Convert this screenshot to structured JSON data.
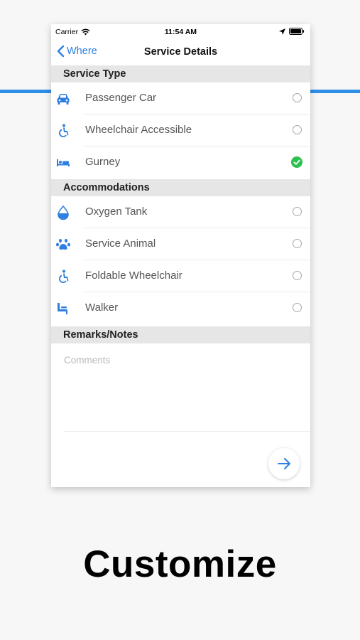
{
  "status_bar": {
    "carrier": "Carrier",
    "time": "11:54 AM"
  },
  "nav": {
    "back_label": "Where",
    "title": "Service Details"
  },
  "service_type": {
    "header": "Service Type",
    "items": [
      {
        "label": "Passenger Car",
        "icon": "car-icon",
        "selected": false
      },
      {
        "label": "Wheelchair Accessible",
        "icon": "wheelchair-icon",
        "selected": false
      },
      {
        "label": "Gurney",
        "icon": "bed-icon",
        "selected": true
      }
    ]
  },
  "accommodations": {
    "header": "Accommodations",
    "items": [
      {
        "label": "Oxygen Tank",
        "icon": "water-drop-icon",
        "selected": false
      },
      {
        "label": "Service Animal",
        "icon": "paw-icon",
        "selected": false
      },
      {
        "label": "Foldable Wheelchair",
        "icon": "wheelchair-icon",
        "selected": false
      },
      {
        "label": "Walker",
        "icon": "chair-icon",
        "selected": false
      }
    ]
  },
  "remarks": {
    "header": "Remarks/Notes",
    "placeholder": "Comments"
  },
  "headline": "Customize",
  "colors": {
    "accent": "#2f7fe0",
    "check": "#2fbf4f",
    "section_bg": "#e6e6e6"
  }
}
